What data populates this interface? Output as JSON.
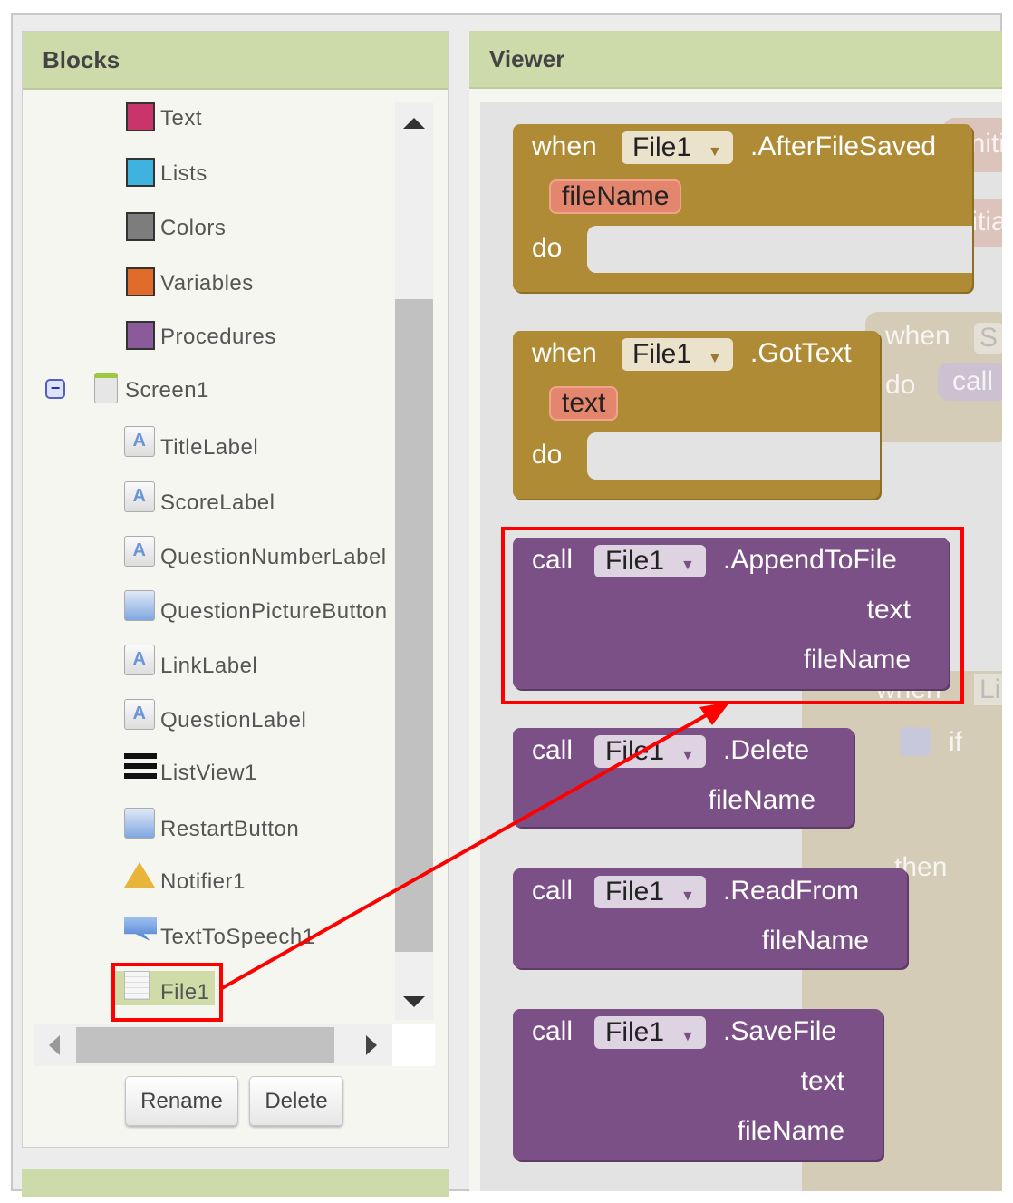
{
  "blocks_panel": {
    "title": "Blocks",
    "categories": [
      {
        "label": "Text",
        "color": "#c9356a"
      },
      {
        "label": "Lists",
        "color": "#3fb2e0"
      },
      {
        "label": "Colors",
        "color": "#7d7d7d"
      },
      {
        "label": "Variables",
        "color": "#e06b2b"
      },
      {
        "label": "Procedures",
        "color": "#8b5a9a"
      }
    ],
    "screen": {
      "label": "Screen1",
      "collapse": "−"
    },
    "components": [
      {
        "label": "TitleLabel",
        "icon": "label-icon"
      },
      {
        "label": "ScoreLabel",
        "icon": "label-icon"
      },
      {
        "label": "QuestionNumberLabel",
        "icon": "label-icon"
      },
      {
        "label": "QuestionPictureButton",
        "icon": "button-icon"
      },
      {
        "label": "LinkLabel",
        "icon": "label-icon"
      },
      {
        "label": "QuestionLabel",
        "icon": "label-icon"
      },
      {
        "label": "ListView1",
        "icon": "listview-icon"
      },
      {
        "label": "RestartButton",
        "icon": "button-icon"
      },
      {
        "label": "Notifier1",
        "icon": "warning-icon"
      },
      {
        "label": "TextToSpeech1",
        "icon": "speech-icon"
      },
      {
        "label": "File1",
        "icon": "file-icon"
      }
    ],
    "label_glyph": "A",
    "rename_label": "Rename",
    "delete_label": "Delete"
  },
  "viewer": {
    "title": "Viewer",
    "events": [
      {
        "when": "when",
        "component": "File1",
        "event": ".AfterFileSaved",
        "param": "fileName",
        "do": "do"
      },
      {
        "when": "when",
        "component": "File1",
        "event": ".GotText",
        "param": "text",
        "do": "do"
      }
    ],
    "calls": [
      {
        "call": "call",
        "component": "File1",
        "method": ".AppendToFile",
        "args": [
          "text",
          "fileName"
        ]
      },
      {
        "call": "call",
        "component": "File1",
        "method": ".Delete",
        "args": [
          "fileName"
        ]
      },
      {
        "call": "call",
        "component": "File1",
        "method": ".ReadFrom",
        "args": [
          "fileName"
        ]
      },
      {
        "call": "call",
        "component": "File1",
        "method": ".SaveFile",
        "args": [
          "text",
          "fileName"
        ]
      }
    ],
    "background": {
      "initialize1": "initi",
      "initialize2": "initia",
      "when1": "when",
      "s": "S",
      "do1": "do",
      "call1": "call",
      "when2": "when",
      "li": "Li",
      "if": "if",
      "then": "then"
    }
  },
  "dropdown_arrow": "▼",
  "colors": {
    "event": "#b08b35",
    "procedure": "#7b5086",
    "highlight": "#ff0000",
    "header": "#cddaa9"
  }
}
